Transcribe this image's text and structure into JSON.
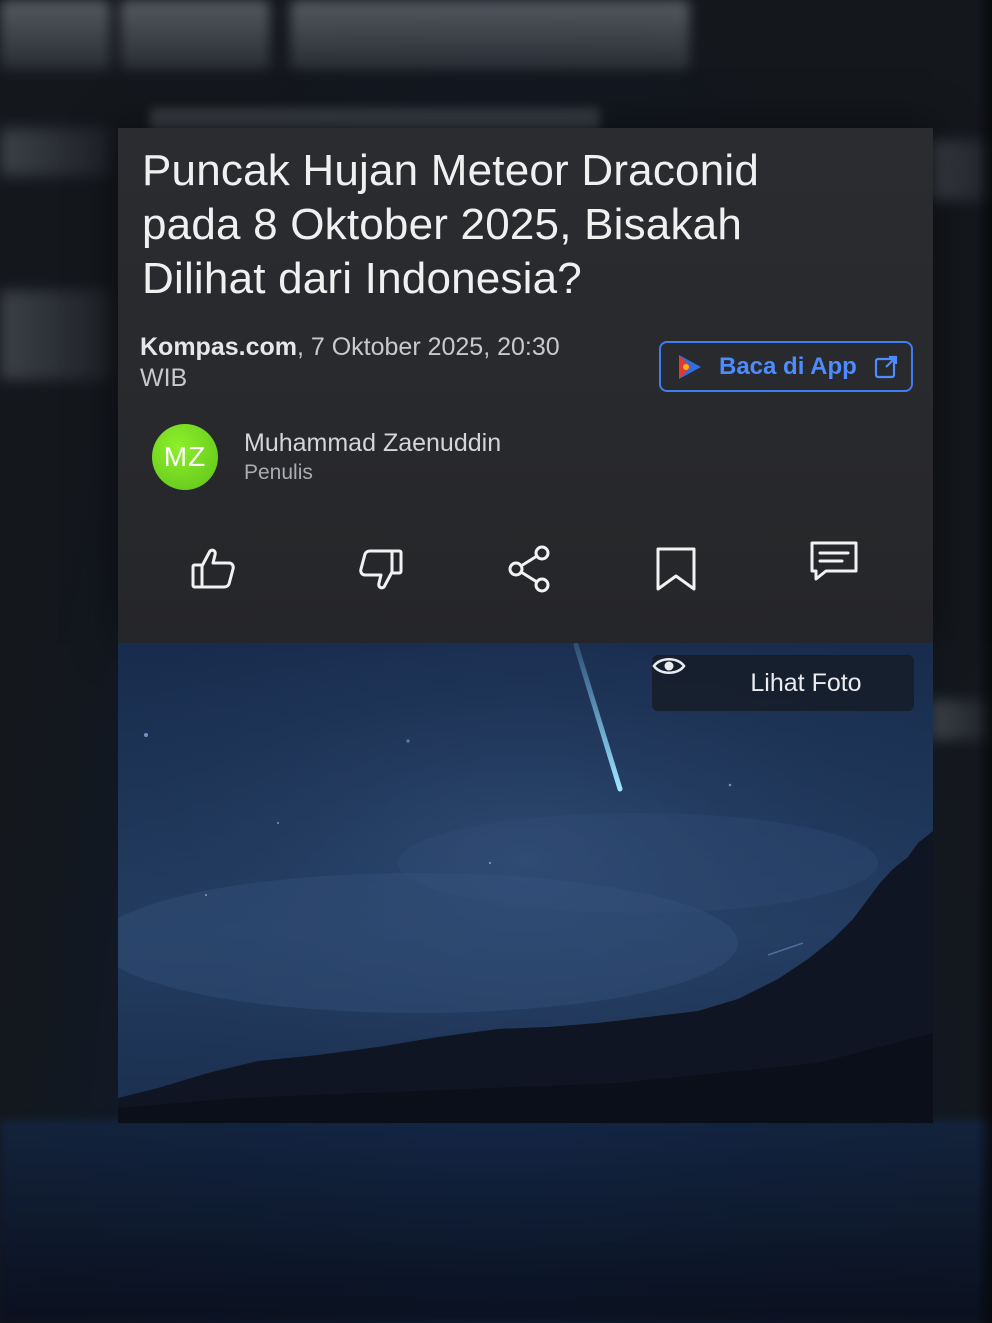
{
  "article": {
    "headline": "Puncak Hujan Meteor Draconid pada 8 Oktober 2025, Bisakah Dilihat dari Indonesia?",
    "source": "Kompas.com",
    "datetime": ", 7 Oktober 2025, 20:30 WIB",
    "app_button_label": "Baca di App",
    "author": {
      "initials": "MZ",
      "name": "Muhammad Zaenuddin",
      "role": "Penulis"
    },
    "photo_button_label": "Lihat Foto"
  },
  "icons": {
    "like": "thumbs-up-icon",
    "dislike": "thumbs-down-icon",
    "share": "share-icon",
    "bookmark": "bookmark-icon",
    "comment": "comment-icon",
    "app_logo": "kompas-app-icon",
    "external": "external-link-icon",
    "eye": "eye-icon"
  },
  "colors": {
    "card_bg": "#2a2c30",
    "accent_blue": "#3f7df0",
    "avatar_green": "#6fd11f",
    "headline_text": "#f0f0f0"
  }
}
